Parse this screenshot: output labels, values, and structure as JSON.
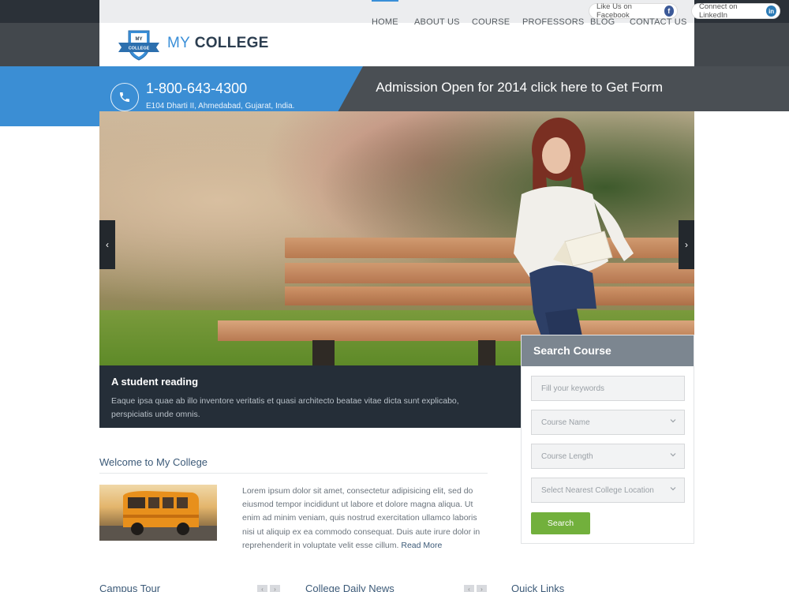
{
  "topbar": {
    "facebook_label": "Like Us on Facebook",
    "linkedin_label": "Connect on LinkedIn"
  },
  "logo": {
    "badge_top": "MY",
    "badge_ribbon": "COLLEGE",
    "word_my": "MY",
    "word_college": "COLLEGE"
  },
  "nav": {
    "items": [
      "HOME",
      "ABOUT US",
      "COURSE",
      "PROFESSORS",
      "BLOG",
      "CONTACT US"
    ],
    "active": "HOME"
  },
  "contact": {
    "phone": "1-800-643-4300",
    "address": "E104 Dharti II, Ahmedabad, Gujarat, India."
  },
  "admission_banner": "Admission Open for 2014 click here to Get Form",
  "slider": {
    "prev": "‹",
    "next": "›",
    "caption_title": "A student reading",
    "caption_text": "Eaque ipsa quae ab illo inventore veritatis et quasi architecto beatae vitae dicta sunt explicabo, perspiciatis unde omnis."
  },
  "search": {
    "title": "Search Course",
    "keywords_placeholder": "Fill your keywords",
    "course_name": "Course Name",
    "course_length": "Course Length",
    "location": "Select Nearest College Location",
    "button": "Search"
  },
  "welcome": {
    "title": "Welcome to My College",
    "body": "Lorem ipsum dolor sit amet, consectetur adipisicing elit, sed do eiusmod tempor incididunt ut labore et dolore magna aliqua. Ut enim ad minim veniam, quis nostrud exercitation ullamco laboris nisi ut aliquip ex ea commodo consequat. Duis aute irure dolor in reprehenderit in voluptate velit esse cillum.",
    "read_more": "Read More"
  },
  "bottom": {
    "campus_tour": "Campus Tour",
    "daily_news": "College Daily News",
    "quick_links": "Quick Links",
    "prev": "‹",
    "next": "›"
  },
  "colors": {
    "accent_blue": "#3b8ed4",
    "dark": "#43484d",
    "caption_bg": "#252e38",
    "search_button": "#72b03c"
  }
}
